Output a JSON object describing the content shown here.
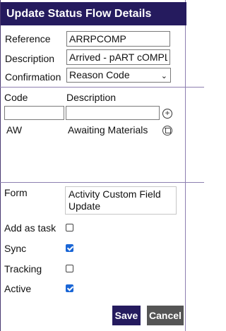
{
  "dialog": {
    "title": "Update Status Flow Details"
  },
  "fields": {
    "reference": {
      "label": "Reference",
      "value": "ARRPCOMP"
    },
    "description": {
      "label": "Description",
      "value": "Arrived - pART cOMPLETE"
    },
    "confirmation": {
      "label": "Confirmation",
      "value": "Reason Code"
    }
  },
  "codes_table": {
    "headers": {
      "code": "Code",
      "description": "Description"
    },
    "new_row": {
      "code": "",
      "description": ""
    },
    "rows": [
      {
        "code": "AW",
        "description": "Awaiting Materials"
      }
    ]
  },
  "form": {
    "label": "Form",
    "value": "Activity Custom Field Update"
  },
  "options": [
    {
      "label": "Add as task",
      "checked": false
    },
    {
      "label": "Sync",
      "checked": true
    },
    {
      "label": "Tracking",
      "checked": false
    },
    {
      "label": "Active",
      "checked": true
    }
  ],
  "buttons": {
    "save": "Save",
    "cancel": "Cancel"
  },
  "colors": {
    "header": "#251b5e",
    "cancel": "#555555",
    "checkbox_on": "#1a66d6",
    "divider": "#8d7fb0"
  },
  "icons": {
    "add": "plus-circle-icon",
    "delete": "trash-icon"
  }
}
